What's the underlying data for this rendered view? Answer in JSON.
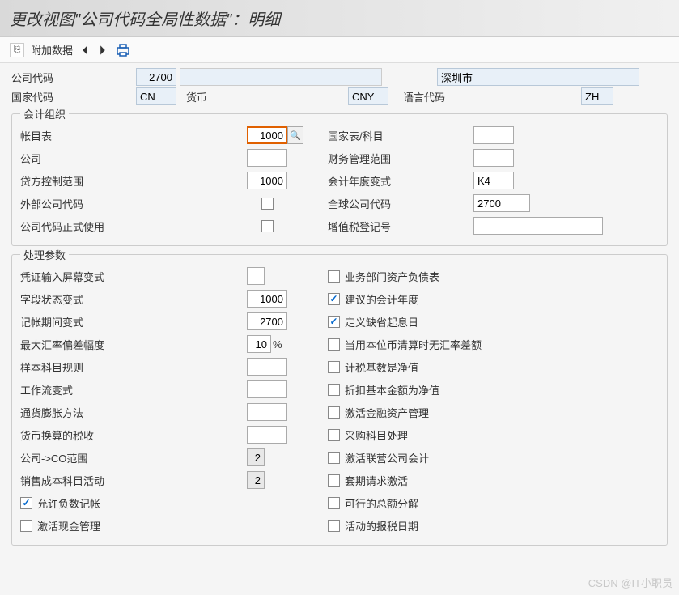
{
  "title": "更改视图\"公司代码全局性数据\"：明细",
  "toolbar": {
    "addl_data": "附加数据"
  },
  "header": {
    "company_code_label": "公司代码",
    "company_code": "2700",
    "city": "深圳市",
    "country_label": "国家代码",
    "country": "CN",
    "currency_label": "货币",
    "currency": "CNY",
    "language_label": "语言代码",
    "language": "ZH"
  },
  "group1": {
    "title": "会计组织",
    "chart_of_accounts_label": "帐目表",
    "chart_of_accounts": "1000",
    "country_chart_label": "国家表/科目",
    "country_chart": "",
    "company_label": "公司",
    "company": "",
    "fm_area_label": "财务管理范围",
    "fm_area": "",
    "credit_ctrl_label": "贷方控制范围",
    "credit_ctrl": "1000",
    "fiscal_variant_label": "会计年度变式",
    "fiscal_variant": "K4",
    "ext_company_label": "外部公司代码",
    "global_company_label": "全球公司代码",
    "global_company": "2700",
    "productive_label": "公司代码正式使用",
    "vat_reg_label": "增值税登记号",
    "vat_reg": ""
  },
  "group2": {
    "title": "处理参数",
    "doc_entry_label": "凭证输入屏幕变式",
    "doc_entry": "",
    "biz_bs_label": "业务部门资产负债表",
    "field_status_label": "字段状态变式",
    "field_status": "1000",
    "propose_fy_label": "建议的会计年度",
    "posting_period_label": "记帐期间变式",
    "posting_period": "2700",
    "default_vd_label": "定义缺省起息日",
    "max_exch_label": "最大汇率偏差幅度",
    "max_exch": "10",
    "pct": "%",
    "no_exdiff_lc_label": "当用本位币清算时无汇率差额",
    "sample_rules_label": "样本科目规则",
    "sample_rules": "",
    "tax_base_net_label": "计税基数是净值",
    "workflow_label": "工作流变式",
    "workflow": "",
    "disc_base_net_label": "折扣基本金额为净值",
    "inflation_label": "通货膨胀方法",
    "inflation": "",
    "fin_asset_label": "激活金融资产管理",
    "tax_crcy_label": "货币换算的税收",
    "tax_crcy": "",
    "po_acct_label": "采购科目处理",
    "co_area_label": "公司->CO范围",
    "co_area": "2",
    "jv_acct_label": "激活联营公司会计",
    "cogs_label": "销售成本科目活动",
    "cogs": "2",
    "hedge_req_label": "套期请求激活",
    "neg_post_label": "允许负数记帐",
    "amount_split_label": "可行的总额分解",
    "cash_mgmt_label": "激活现金管理",
    "tax_date_label": "活动的报税日期"
  },
  "watermark": "CSDN @IT小职员"
}
